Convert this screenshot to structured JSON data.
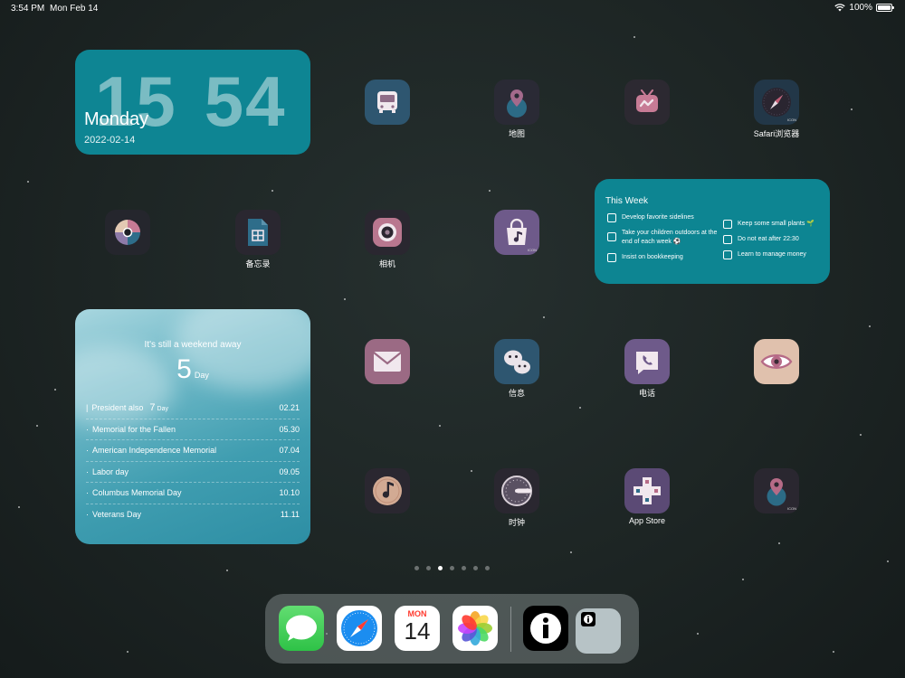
{
  "status_bar": {
    "time": "3:54 PM",
    "date": "Mon Feb 14",
    "battery": "100%"
  },
  "clock_widget": {
    "hours": "15",
    "minutes": "54",
    "day": "Monday",
    "date": "2022-02-14"
  },
  "apps": {
    "bus": {
      "label": ""
    },
    "maps": {
      "label": "地图"
    },
    "tv": {
      "label": ""
    },
    "safari": {
      "label": "Safari浏览器"
    },
    "pinwheel": {
      "label": ""
    },
    "notes": {
      "label": "备忘录"
    },
    "camera": {
      "label": "相机"
    },
    "music_bag": {
      "label": ""
    },
    "mail": {
      "label": ""
    },
    "messages": {
      "label": "信息"
    },
    "phone": {
      "label": "电话"
    },
    "eye": {
      "label": ""
    },
    "music": {
      "label": ""
    },
    "clock": {
      "label": "时钟"
    },
    "app_store": {
      "label": "App Store"
    },
    "location": {
      "label": ""
    }
  },
  "week_widget": {
    "title": "This Week",
    "left_items": [
      "Develop favorite sidelines",
      "Take your children outdoors at the end of each week ⚽",
      "Insist on bookkeeping"
    ],
    "right_items": [
      "Keep some small plants 🌱",
      "Do not eat after 22:30",
      "Learn to manage money"
    ]
  },
  "holiday_widget": {
    "subtitle": "It's still a weekend away",
    "count": "5",
    "unit": "Day",
    "holidays": [
      {
        "marker": "|",
        "name": "President also",
        "days": "7",
        "days_unit": "Day",
        "date": "02.21"
      },
      {
        "marker": "·",
        "name": "Memorial for the Fallen",
        "date": "05.30"
      },
      {
        "marker": "·",
        "name": "American Independence Memorial",
        "date": "07.04"
      },
      {
        "marker": "·",
        "name": "Labor day",
        "date": "09.05"
      },
      {
        "marker": "·",
        "name": "Columbus Memorial Day",
        "date": "10.10"
      },
      {
        "marker": "·",
        "name": "Veterans Day",
        "date": "11.11"
      }
    ]
  },
  "dock": {
    "calendar_month": "MON",
    "calendar_day": "14"
  },
  "colors": {
    "widget_teal": "#0e8593",
    "messages_green": "#34c759"
  }
}
